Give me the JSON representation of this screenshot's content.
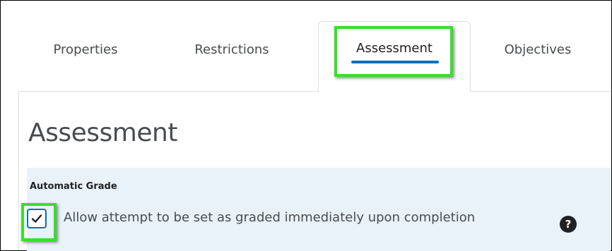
{
  "tabs": [
    {
      "label": "Properties"
    },
    {
      "label": "Restrictions"
    },
    {
      "label": "Assessment",
      "active": true
    },
    {
      "label": "Objectives"
    }
  ],
  "page_title": "Assessment",
  "section": {
    "label": "Automatic Grade",
    "checkbox": {
      "checked": true,
      "label": "Allow attempt to be set as graded immediately upon completion"
    },
    "help_icon": "question-circle-icon"
  },
  "help_glyph": "?",
  "colors": {
    "accent": "#006fbf",
    "highlight": "#33e226",
    "section_bg": "#e9f2f9"
  }
}
